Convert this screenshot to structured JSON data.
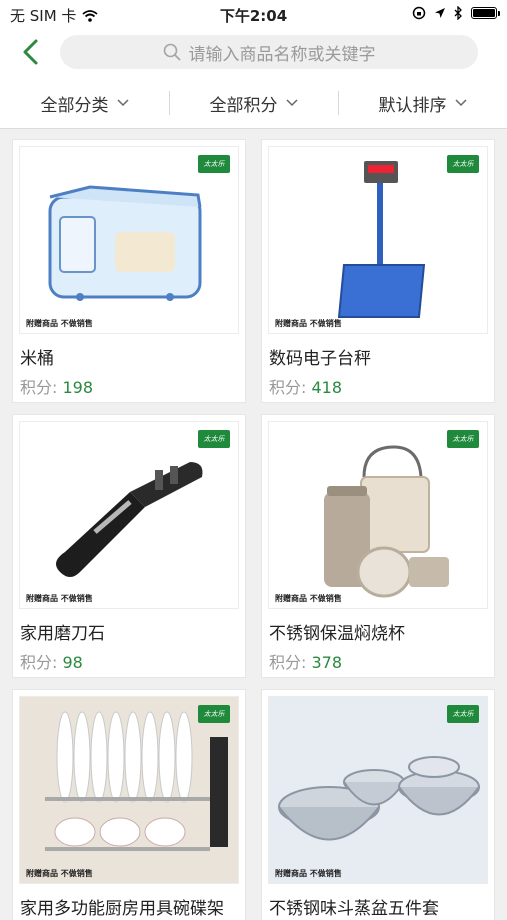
{
  "status_bar": {
    "carrier": "无 SIM 卡",
    "time": "下午2:04",
    "battery_fill_fraction": 0.9
  },
  "header": {
    "back_icon": "chevron-left-icon",
    "search_placeholder": "请输入商品名称或关键字"
  },
  "filters": [
    {
      "label": "全部分类"
    },
    {
      "label": "全部积分"
    },
    {
      "label": "默认排序"
    }
  ],
  "products": [
    {
      "name": "米桶",
      "points_label": "积分:",
      "points": "198",
      "logo_text": "太太乐",
      "note": "附赠商品 不做销售"
    },
    {
      "name": "数码电子台秤",
      "points_label": "积分:",
      "points": "418",
      "logo_text": "太太乐",
      "note": "附赠商品 不做销售"
    },
    {
      "name": "家用磨刀石",
      "points_label": "积分:",
      "points": "98",
      "logo_text": "太太乐",
      "note": "附赠商品 不做销售"
    },
    {
      "name": "不锈钢保温焖烧杯",
      "points_label": "积分:",
      "points": "378",
      "logo_text": "太太乐",
      "note": "附赠商品 不做销售"
    },
    {
      "name": "家用多功能厨房用具碗碟架",
      "points_label": "",
      "points": "",
      "logo_text": "太太乐",
      "note": "附赠商品 不做销售"
    },
    {
      "name": "不锈钢味斗蒸盆五件套",
      "points_label": "",
      "points": "",
      "logo_text": "太太乐",
      "note": "附赠商品 不做销售"
    }
  ],
  "colors": {
    "accent_green": "#2b8a3e",
    "logo_green": "#1f8a3c"
  }
}
